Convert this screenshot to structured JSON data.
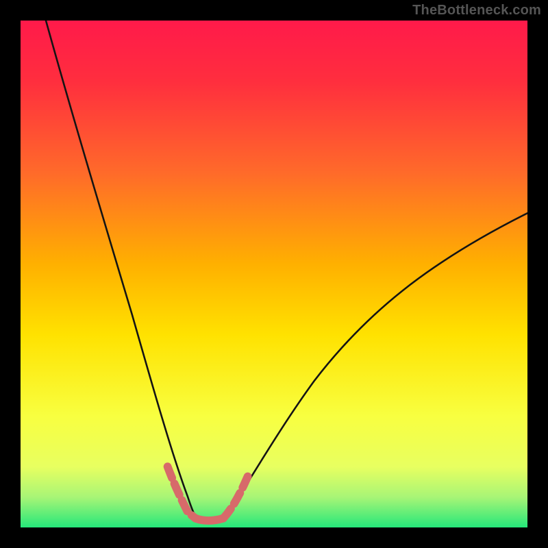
{
  "watermark": "TheBottleneck.com",
  "colors": {
    "bg_black": "#000000",
    "grad_top": "#ff1a3a",
    "grad_mid1": "#ff6a2a",
    "grad_mid2": "#ffd400",
    "grad_mid3": "#f6ff45",
    "grad_bot": "#25e77a",
    "curve": "#1a1a1a",
    "marker": "#d76a6a",
    "watermark_text": "#555555"
  },
  "chart_data": {
    "type": "line",
    "title": "",
    "xlabel": "",
    "ylabel": "",
    "xlim": [
      0,
      100
    ],
    "ylim": [
      0,
      100
    ],
    "description": "Two curve branches forming a V-shape. Left branch starts near top-left (≈x=5,y=100) and descends steeply to a flat minimum around x=34–40, y≈0–3. Right branch rises with decreasing slope from the minimum toward upper-right (≈x=100, y≈62). Coral marker segments trace the curve where it enters the bottom ~10% of the plot (approx x=29–34 on the left descent, x=34–40 along the flat bottom, and x=40–45 on the right ascent).",
    "series": [
      {
        "name": "left-branch",
        "x": [
          5,
          8,
          12,
          16,
          20,
          24,
          28,
          31,
          33,
          34
        ],
        "values": [
          100,
          87,
          72,
          58,
          44,
          31,
          18,
          9,
          4,
          2
        ]
      },
      {
        "name": "right-branch",
        "x": [
          40,
          43,
          47,
          52,
          58,
          65,
          73,
          82,
          91,
          100
        ],
        "values": [
          2,
          6,
          12,
          20,
          28,
          36,
          43,
          50,
          56,
          62
        ]
      },
      {
        "name": "valley-floor",
        "x": [
          34,
          36,
          38,
          40
        ],
        "values": [
          2,
          1,
          1,
          2
        ]
      }
    ],
    "markers": [
      {
        "name": "left-entry",
        "x": [
          29,
          30.5,
          32,
          33,
          34
        ],
        "values": [
          12,
          8,
          5,
          3,
          2
        ]
      },
      {
        "name": "floor",
        "x": [
          34,
          36,
          38,
          40
        ],
        "values": [
          2,
          1,
          1,
          2
        ]
      },
      {
        "name": "right-exit",
        "x": [
          40,
          42,
          43.5,
          45
        ],
        "values": [
          2,
          5,
          8,
          11
        ]
      }
    ],
    "gradient_bands_y": [
      {
        "y": 100,
        "color": "#ff1a3a"
      },
      {
        "y": 60,
        "color": "#ff8a2a"
      },
      {
        "y": 35,
        "color": "#ffd400"
      },
      {
        "y": 15,
        "color": "#f6ff45"
      },
      {
        "y": 3,
        "color": "#25e77a"
      }
    ]
  }
}
